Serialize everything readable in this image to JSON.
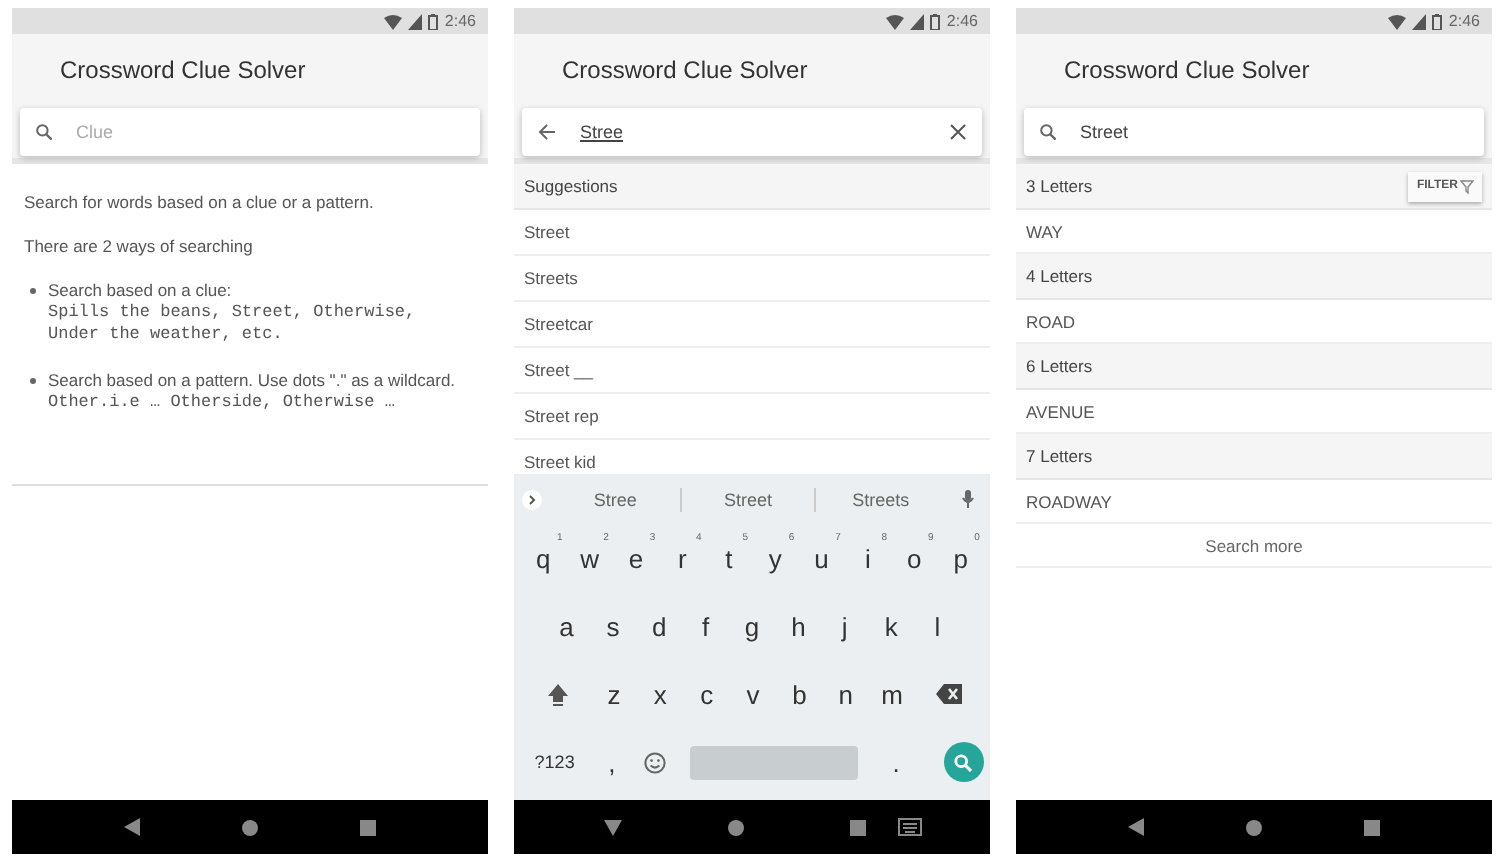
{
  "screens": [
    {
      "kind": "help",
      "status": {
        "time": "2:46"
      },
      "title": "Crossword Clue Solver",
      "search": {
        "back": false,
        "placeholder": "Clue",
        "clear": false
      },
      "help": {
        "paragraphs": [
          "Search for words based on a clue or a pattern.",
          "There are 2 ways of searching"
        ],
        "bullets": [
          {
            "text": "Search based on a clue:",
            "example": "Spills the beans, Street, Otherwise,\nUnder the weather, etc."
          },
          {
            "text": "Search based on a pattern. Use dots \".\" as a wildcard.",
            "example": "Other.i.e … Otherside, Otherwise …"
          }
        ]
      },
      "nav": {
        "keyboard_open": false
      }
    },
    {
      "kind": "suggestions",
      "status": {
        "time": "2:46"
      },
      "title": "Crossword Clue Solver",
      "search": {
        "back": true,
        "value": "Stree",
        "composing": true,
        "clear": true
      },
      "suggestions": {
        "header": "Suggestions",
        "items": [
          "Street",
          "Streets",
          "Streetcar",
          "Street __",
          "Street rep",
          "Street kid"
        ]
      },
      "keyboard": {
        "strip": [
          "Stree",
          "Street",
          "Streets"
        ],
        "rows": [
          {
            "keys": [
              {
                "kind": "char",
                "label": "q",
                "hint": "1"
              },
              {
                "kind": "char",
                "label": "w",
                "hint": "2"
              },
              {
                "kind": "char",
                "label": "e",
                "hint": "3"
              },
              {
                "kind": "char",
                "label": "r",
                "hint": "4"
              },
              {
                "kind": "char",
                "label": "t",
                "hint": "5"
              },
              {
                "kind": "char",
                "label": "y",
                "hint": "6"
              },
              {
                "kind": "char",
                "label": "u",
                "hint": "7"
              },
              {
                "kind": "char",
                "label": "i",
                "hint": "8"
              },
              {
                "kind": "char",
                "label": "o",
                "hint": "9"
              },
              {
                "kind": "char",
                "label": "p",
                "hint": "0"
              }
            ]
          },
          {
            "keys": [
              {
                "kind": "char",
                "label": "a"
              },
              {
                "kind": "char",
                "label": "s"
              },
              {
                "kind": "char",
                "label": "d"
              },
              {
                "kind": "char",
                "label": "f"
              },
              {
                "kind": "char",
                "label": "g"
              },
              {
                "kind": "char",
                "label": "h"
              },
              {
                "kind": "char",
                "label": "j"
              },
              {
                "kind": "char",
                "label": "k"
              },
              {
                "kind": "char",
                "label": "l"
              }
            ]
          },
          {
            "keys": [
              {
                "kind": "shift"
              },
              {
                "kind": "char",
                "label": "z"
              },
              {
                "kind": "char",
                "label": "x"
              },
              {
                "kind": "char",
                "label": "c"
              },
              {
                "kind": "char",
                "label": "v"
              },
              {
                "kind": "char",
                "label": "b"
              },
              {
                "kind": "char",
                "label": "n"
              },
              {
                "kind": "char",
                "label": "m"
              },
              {
                "kind": "backspace"
              }
            ]
          },
          {
            "keys": [
              {
                "kind": "char",
                "label": "?123"
              },
              {
                "kind": "char",
                "label": ","
              },
              {
                "kind": "emoji"
              },
              {
                "kind": "space"
              },
              {
                "kind": "char",
                "label": "."
              },
              {
                "kind": "search"
              }
            ]
          }
        ]
      },
      "nav": {
        "keyboard_open": true
      }
    },
    {
      "kind": "results",
      "status": {
        "time": "2:46"
      },
      "title": "Crossword Clue Solver",
      "search": {
        "back": false,
        "value": "Street",
        "composing": false,
        "clear": false
      },
      "results": {
        "filter": "FILTER",
        "groups": [
          {
            "header": "3 Letters",
            "words": [
              "WAY"
            ]
          },
          {
            "header": "4 Letters",
            "words": [
              "ROAD"
            ]
          },
          {
            "header": "6 Letters",
            "words": [
              "AVENUE"
            ]
          },
          {
            "header": "7 Letters",
            "words": [
              "ROADWAY"
            ]
          }
        ],
        "more": "Search more"
      },
      "nav": {
        "keyboard_open": false
      }
    }
  ]
}
